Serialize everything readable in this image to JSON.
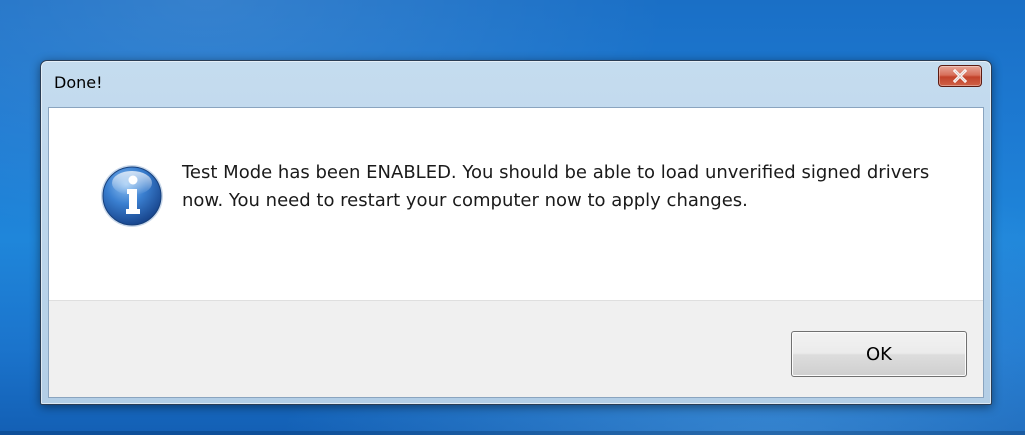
{
  "dialog": {
    "title": "Done!",
    "message": "Test Mode has been ENABLED. You should be able to load unverified signed drivers now. You need to restart your computer now to apply changes.",
    "icon": "info-icon",
    "buttons": {
      "ok_label": "OK"
    },
    "close_icon": "close-icon"
  },
  "colors": {
    "desktop": "#1d7ad2",
    "close_button": "#c2432b",
    "info_icon": "#1f5aa8"
  }
}
